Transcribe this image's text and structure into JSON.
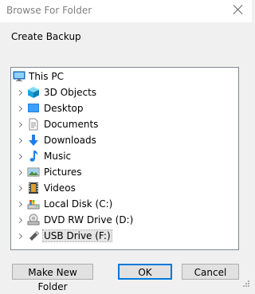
{
  "window": {
    "title": "Browse For Folder",
    "description": "Create Backup"
  },
  "tree": {
    "root": {
      "label": "This PC",
      "icon": "computer-icon"
    },
    "items": [
      {
        "label": "3D Objects",
        "icon": "3d-objects-icon",
        "selected": false
      },
      {
        "label": "Desktop",
        "icon": "desktop-icon",
        "selected": false
      },
      {
        "label": "Documents",
        "icon": "documents-icon",
        "selected": false
      },
      {
        "label": "Downloads",
        "icon": "downloads-icon",
        "selected": false
      },
      {
        "label": "Music",
        "icon": "music-icon",
        "selected": false
      },
      {
        "label": "Pictures",
        "icon": "pictures-icon",
        "selected": false
      },
      {
        "label": "Videos",
        "icon": "videos-icon",
        "selected": false
      },
      {
        "label": "Local Disk (C:)",
        "icon": "local-disk-icon",
        "selected": false
      },
      {
        "label": "DVD RW Drive (D:)",
        "icon": "dvd-drive-icon",
        "selected": false
      },
      {
        "label": "USB Drive (F:)",
        "icon": "usb-drive-icon",
        "selected": true
      }
    ]
  },
  "buttons": {
    "make_new_folder": "Make New Folder",
    "ok": "OK",
    "cancel": "Cancel"
  },
  "colors": {
    "accent": "#0078d7",
    "selection": "#e5e5e5"
  }
}
